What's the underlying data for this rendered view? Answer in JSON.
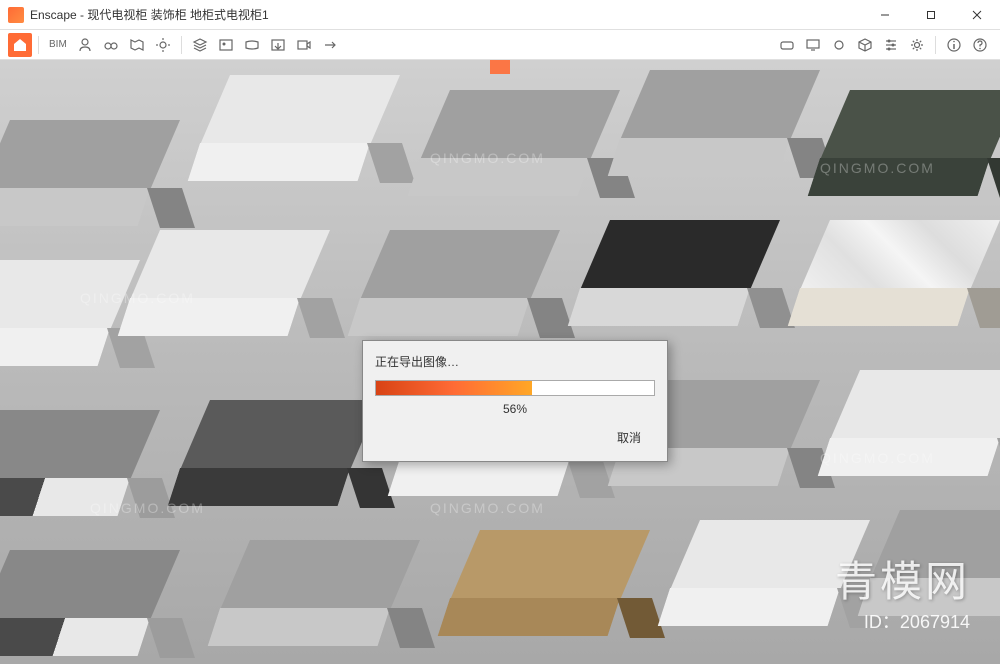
{
  "app": {
    "name": "Enscape",
    "window_title": "Enscape - 现代电视柜 装饰柜 地柜式电视柜1"
  },
  "toolbar": {
    "bim_label": "BIM"
  },
  "dialog": {
    "title": "正在导出图像…",
    "progress_percent": 56,
    "progress_text": "56%",
    "cancel_label": "取消"
  },
  "watermark": {
    "text": "QINGMO.COM",
    "brand": "青模网",
    "model_id": "ID：2067914"
  },
  "colors": {
    "accent": "#ff6b35",
    "progress_start": "#d84315",
    "progress_end": "#ffa726"
  }
}
